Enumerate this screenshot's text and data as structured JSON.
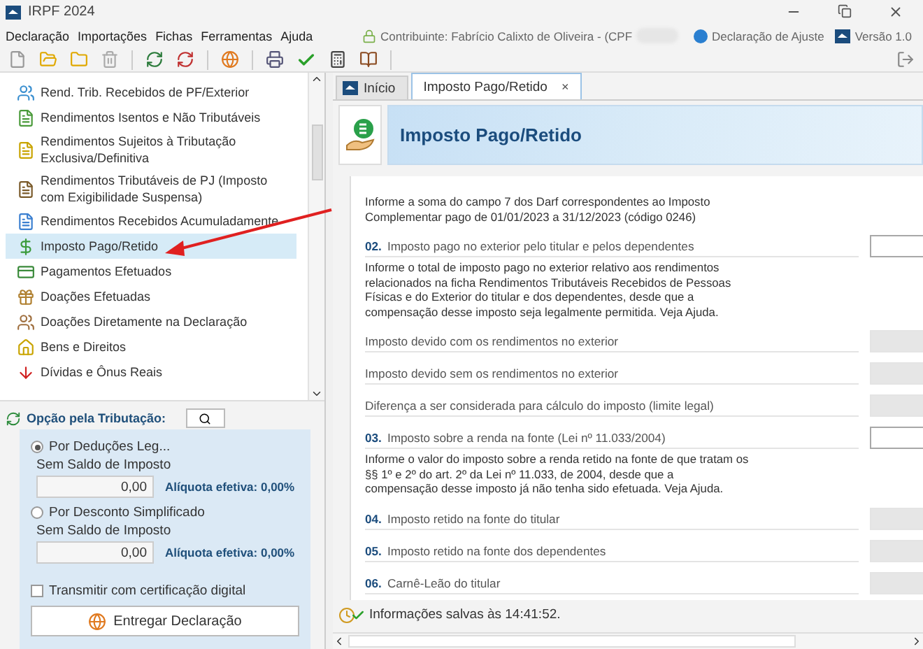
{
  "window": {
    "title": "IRPF 2024"
  },
  "menu": [
    "Declaração",
    "Importações",
    "Fichas",
    "Ferramentas",
    "Ajuda"
  ],
  "info_bar": {
    "contributor": "Contribuinte: Fabrício Calixto de Oliveira - (CPF",
    "declaration_type": "Declaração de Ajuste",
    "version": "Versão 1.0"
  },
  "sidebar": {
    "items": [
      {
        "label": "Rend. Trib. Recebidos de PF/Exterior",
        "selected": false
      },
      {
        "label": "Rendimentos Isentos e Não Tributáveis",
        "selected": false
      },
      {
        "label": "Rendimentos Sujeitos à Tributação Exclusiva/Definitiva",
        "selected": false
      },
      {
        "label": "Rendimentos Tributáveis de PJ (Imposto com Exigibilidade Suspensa)",
        "selected": false
      },
      {
        "label": "Rendimentos Recebidos Acumuladamente",
        "selected": false
      },
      {
        "label": "Imposto Pago/Retido",
        "selected": true
      },
      {
        "label": "Pagamentos Efetuados",
        "selected": false
      },
      {
        "label": "Doações Efetuadas",
        "selected": false
      },
      {
        "label": "Doações Diretamente na Declaração",
        "selected": false
      },
      {
        "label": "Bens e Direitos",
        "selected": false
      },
      {
        "label": "Dívidas e Ônus Reais",
        "selected": false
      }
    ]
  },
  "tax_option": {
    "title": "Opção pela Tributação:",
    "options": [
      {
        "label": "Por Deduções Leg...",
        "selected": true,
        "balance_label": "Sem Saldo de Imposto",
        "value": "0,00",
        "rate": "Alíquota efetiva: 0,00%"
      },
      {
        "label": "Por Desconto Simplificado",
        "selected": false,
        "balance_label": "Sem Saldo de Imposto",
        "value": "0,00",
        "rate": "Alíquota efetiva: 0,00%"
      }
    ],
    "digital_certificate": {
      "label": "Transmitir com certificação digital",
      "checked": false
    },
    "submit_button": "Entregar Declaração"
  },
  "tabs": [
    {
      "label": "Início",
      "selected": false
    },
    {
      "label": "Imposto Pago/Retido",
      "selected": true,
      "close": "×"
    }
  ],
  "header": {
    "title": "Imposto Pago/Retido"
  },
  "form": {
    "rows": [
      {
        "kind": "description",
        "text": "Informe a soma do campo 7 dos Darf correspondentes ao Imposto Complementar pago de 01/01/2023 a 31/12/2023 (código 0246)"
      },
      {
        "kind": "field",
        "number": "02.",
        "label": "Imposto pago no exterior pelo titular e pelos dependentes",
        "disabled": false
      },
      {
        "kind": "description",
        "text": "Informe o total de imposto pago no exterior relativo aos rendimentos relacionados na ficha Rendimentos Tributáveis Recebidos de Pessoas Físicas e do Exterior do titular e dos dependentes, desde que a compensação desse imposto seja legalmente permitida. Veja Ajuda."
      },
      {
        "kind": "field",
        "label": "Imposto devido com os rendimentos no exterior",
        "disabled": true
      },
      {
        "kind": "field",
        "label": "Imposto devido sem os rendimentos no exterior",
        "disabled": true
      },
      {
        "kind": "field",
        "label": "Diferença a ser considerada para cálculo do imposto (limite legal)",
        "disabled": true
      },
      {
        "kind": "field",
        "number": "03.",
        "label": "Imposto sobre a renda na fonte (Lei nº 11.033/2004)",
        "disabled": false
      },
      {
        "kind": "description",
        "text": "Informe o valor do imposto sobre a renda retido na fonte de que tratam os §§ 1º e 2º do art. 2º da Lei nº 11.033, de 2004, desde que a compensação desse imposto já não tenha sido efetuada. Veja Ajuda."
      },
      {
        "kind": "field",
        "number": "04.",
        "label": "Imposto retido na fonte do titular",
        "disabled": true
      },
      {
        "kind": "field",
        "number": "05.",
        "label": "Imposto retido na fonte dos dependentes",
        "disabled": true
      },
      {
        "kind": "field",
        "number": "06.",
        "label": "Carnê-Leão do titular",
        "disabled": true
      }
    ]
  },
  "status_bar": {
    "text": "Informações salvas às 14:41:52."
  }
}
